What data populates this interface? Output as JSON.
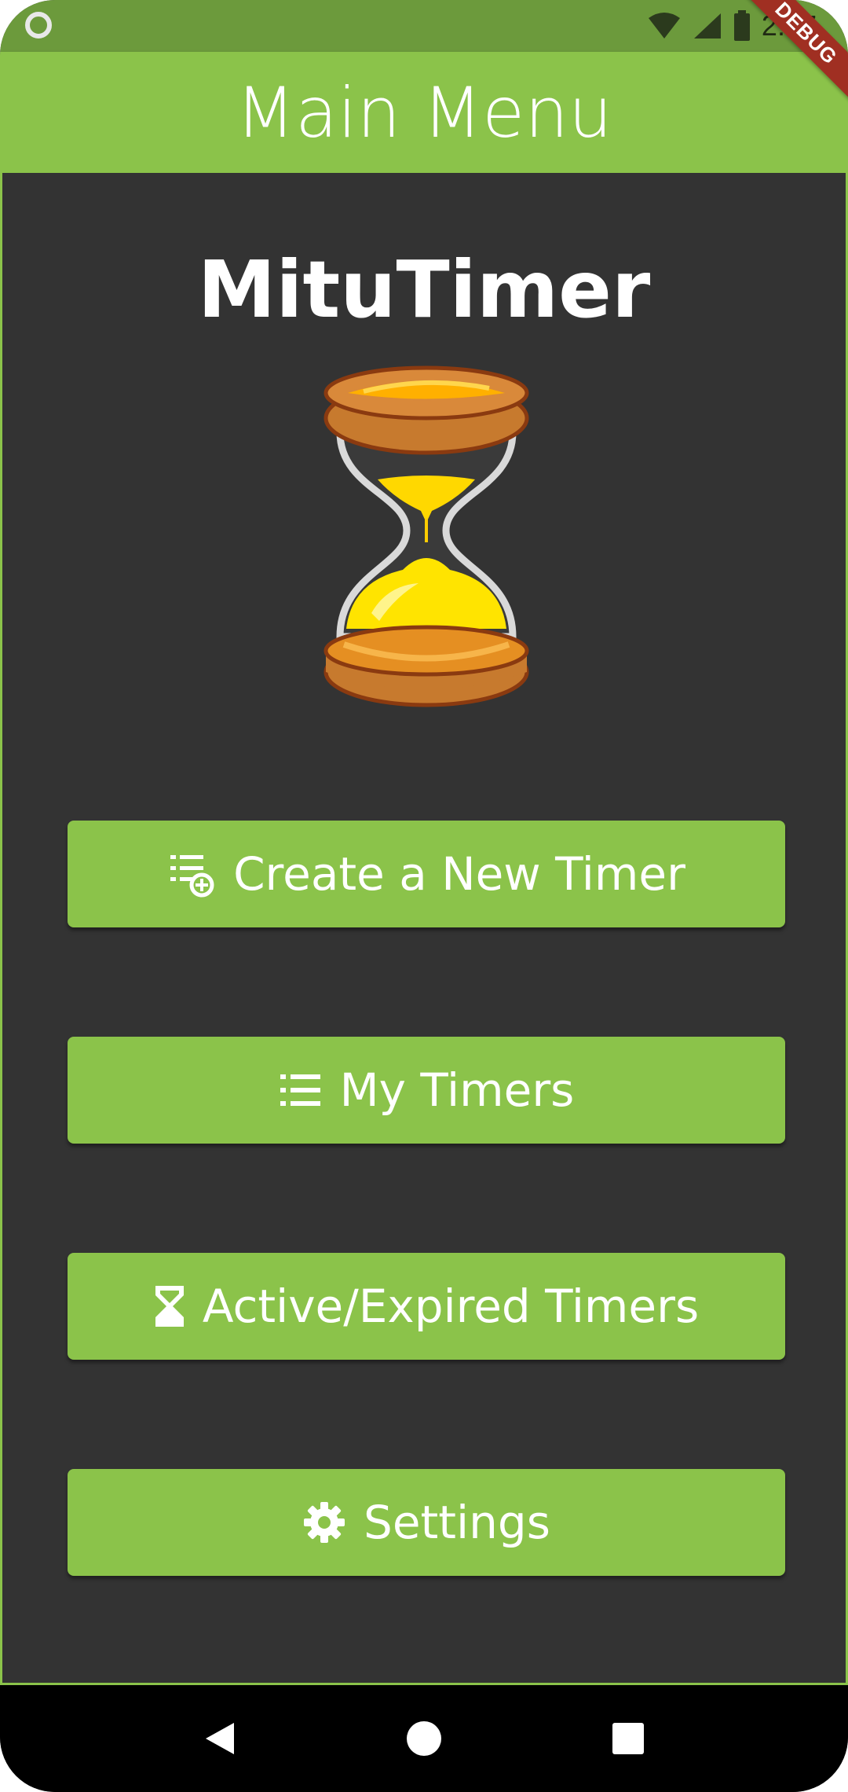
{
  "status_bar": {
    "time": "2:47"
  },
  "debug_banner": {
    "label": "DEBUG"
  },
  "app_bar": {
    "title": "Main Menu"
  },
  "main": {
    "app_name": "MituTimer",
    "buttons": [
      {
        "label": "Create a New Timer",
        "icon": "playlist-add-icon"
      },
      {
        "label": "My Timers",
        "icon": "list-icon"
      },
      {
        "label": "Active/Expired Timers",
        "icon": "hourglass-icon"
      },
      {
        "label": "Settings",
        "icon": "gear-icon"
      }
    ]
  },
  "nav_bar": {
    "items": [
      "back-icon",
      "home-icon",
      "recents-icon"
    ]
  },
  "colors": {
    "primary": "#8bc34a",
    "status_bar": "#6c9a3c",
    "background": "#333333",
    "debug": "#a02f22",
    "text": "#ffffff"
  }
}
